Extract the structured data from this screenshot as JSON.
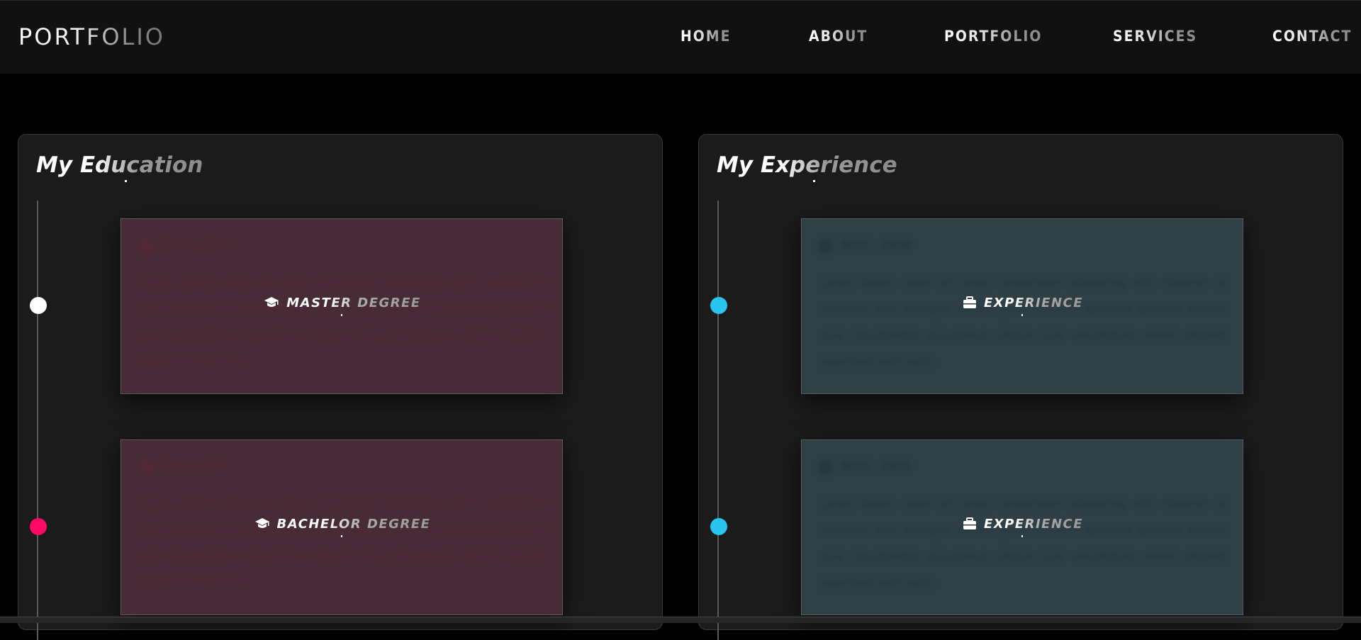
{
  "brand": {
    "logo": "PORTFOLIO"
  },
  "nav": [
    {
      "label": "HOME"
    },
    {
      "label": "ABOUT"
    },
    {
      "label": "PORTFOLIO"
    },
    {
      "label": "SERVICES"
    },
    {
      "label": "CONTACT"
    }
  ],
  "education": {
    "title": "My Education",
    "entries": [
      {
        "label": "MASTER DEGREE",
        "dot_color": "#ffffff",
        "icon": "graduation-cap-icon"
      },
      {
        "label": "BACHELOR DEGREE",
        "dot_color": "#ff0a62",
        "icon": "graduation-cap-icon"
      }
    ]
  },
  "experience": {
    "title": "My Experience",
    "entries": [
      {
        "label": "EXPERIENCE",
        "dot_color": "#29c5ef",
        "icon": "briefcase-icon"
      },
      {
        "label": "EXPERIENCE",
        "dot_color": "#29c5ef",
        "icon": "briefcase-icon"
      }
    ]
  },
  "colors": {
    "page_bg": "#000000",
    "card_bg": "#1b1b1b",
    "education_box_bg": "#472c37",
    "experience_box_bg": "#2f3f46",
    "accent_pink": "#ff0a62",
    "accent_cyan": "#29c5ef"
  }
}
